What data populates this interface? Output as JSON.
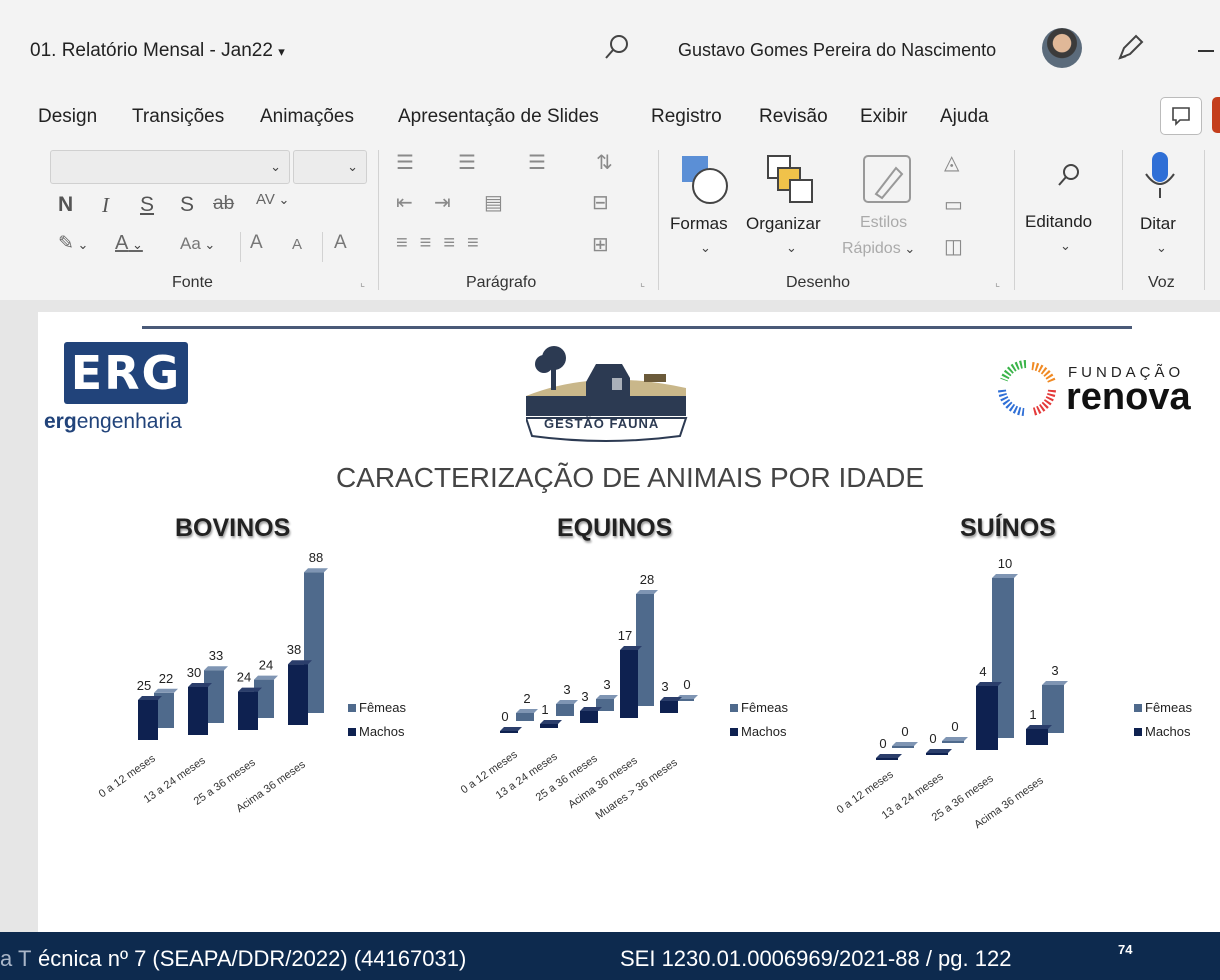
{
  "window": {
    "doc_title": "01. Relatório Mensal - Jan22",
    "user_name": "Gustavo Gomes Pereira do Nascimento",
    "icons": [
      "search-icon",
      "pen-icon",
      "minimize-icon",
      "comment-icon"
    ]
  },
  "menu": {
    "items": [
      "Design",
      "Transições",
      "Animações",
      "Apresentação de Slides",
      "Registro",
      "Revisão",
      "Exibir",
      "Ajuda"
    ]
  },
  "ribbon": {
    "font_group": "Fonte",
    "font_buttons": {
      "bold": "N",
      "italic": "I",
      "underline": "S",
      "shadow": "S",
      "strike": "ab",
      "spacing": "AV",
      "color": "A",
      "case": "Aa",
      "grow": "A",
      "shrink": "A"
    },
    "paragraph_group": "Parágrafo",
    "drawing_group": "Desenho",
    "shapes": "Formas",
    "arrange": "Organizar",
    "quick_styles_1": "Estilos",
    "quick_styles_2": "Rápidos",
    "editing": "Editando",
    "dictate": "Ditar",
    "voice_group": "Voz"
  },
  "slide": {
    "logo_erg": "ERG",
    "logo_erg_sub_bold": "erg",
    "logo_erg_sub": "engenharia",
    "logo_center": "GESTÃO FAUNA",
    "logo_right_top": "FUNDAÇÃO",
    "logo_right": "renova",
    "title": "CARACTERIZAÇÃO DE ANIMAIS POR IDADE"
  },
  "chart_data": [
    {
      "type": "bar",
      "title": "BOVINOS",
      "categories": [
        "0 a 12 meses",
        "13 a 24 meses",
        "25 a 36 meses",
        "Acima 36 meses"
      ],
      "series": [
        {
          "name": "Fêmeas",
          "values": [
            22,
            33,
            24,
            88
          ]
        },
        {
          "name": "Machos",
          "values": [
            25,
            30,
            24,
            38
          ]
        }
      ],
      "legend": "right",
      "colors": {
        "Fêmeas": "#4f6a8c",
        "Machos": "#0e2150"
      }
    },
    {
      "type": "bar",
      "title": "EQUINOS",
      "categories": [
        "0 a 12 meses",
        "13 a 24 meses",
        "25 a 36 meses",
        "Acima 36 meses",
        "Muares > 36 meses"
      ],
      "series": [
        {
          "name": "Fêmeas",
          "values": [
            2,
            3,
            3,
            28,
            0
          ]
        },
        {
          "name": "Machos",
          "values": [
            0,
            1,
            3,
            17,
            3
          ]
        }
      ],
      "legend": "right",
      "colors": {
        "Fêmeas": "#4f6a8c",
        "Machos": "#0e2150"
      }
    },
    {
      "type": "bar",
      "title": "SUÍNOS",
      "categories": [
        "0 a 12 meses",
        "13 a 24 meses",
        "25 a 36 meses",
        "Acima 36 meses"
      ],
      "series": [
        {
          "name": "Fêmeas",
          "values": [
            0,
            0,
            10,
            3
          ]
        },
        {
          "name": "Machos",
          "values": [
            0,
            0,
            4,
            1
          ]
        }
      ],
      "legend": "right",
      "colors": {
        "Fêmeas": "#4f6a8c",
        "Machos": "#0e2150"
      }
    }
  ],
  "footer": {
    "left_prefix": "a T",
    "left": "écnica nº 7 (SEAPA/DDR/2022) (44167031)",
    "right": "SEI 1230.01.0006969/2021-88 / pg. 122",
    "page_sup": "74"
  }
}
